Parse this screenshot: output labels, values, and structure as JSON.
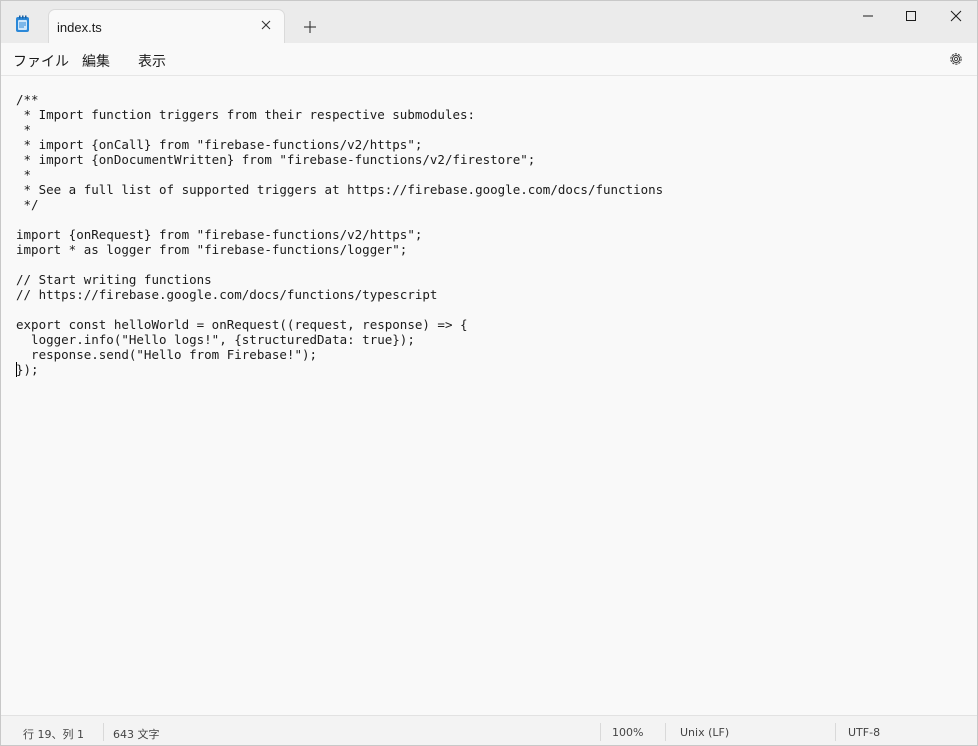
{
  "tab": {
    "title": "index.ts",
    "close_icon": "close-icon",
    "new_tab_icon": "plus-icon"
  },
  "window_controls": {
    "minimize_icon": "minimize-icon",
    "maximize_icon": "maximize-icon",
    "close_icon": "close-icon"
  },
  "menu": {
    "file": "ファイル",
    "edit": "編集",
    "view": "表示",
    "settings_icon": "gear-icon"
  },
  "editor": {
    "lines": [
      "/**",
      " * Import function triggers from their respective submodules:",
      " *",
      " * import {onCall} from \"firebase-functions/v2/https\";",
      " * import {onDocumentWritten} from \"firebase-functions/v2/firestore\";",
      " *",
      " * See a full list of supported triggers at https://firebase.google.com/docs/functions",
      " */",
      "",
      "import {onRequest} from \"firebase-functions/v2/https\";",
      "import * as logger from \"firebase-functions/logger\";",
      "",
      "// Start writing functions",
      "// https://firebase.google.com/docs/functions/typescript",
      "",
      "export const helloWorld = onRequest((request, response) => {",
      "  logger.info(\"Hello logs!\", {structuredData: true});",
      "  response.send(\"Hello from Firebase!\");",
      "});"
    ]
  },
  "status": {
    "position": "行 19、列 1",
    "char_count": "643 文字",
    "zoom": "100%",
    "line_ending": "Unix (LF)",
    "encoding": "UTF-8"
  }
}
